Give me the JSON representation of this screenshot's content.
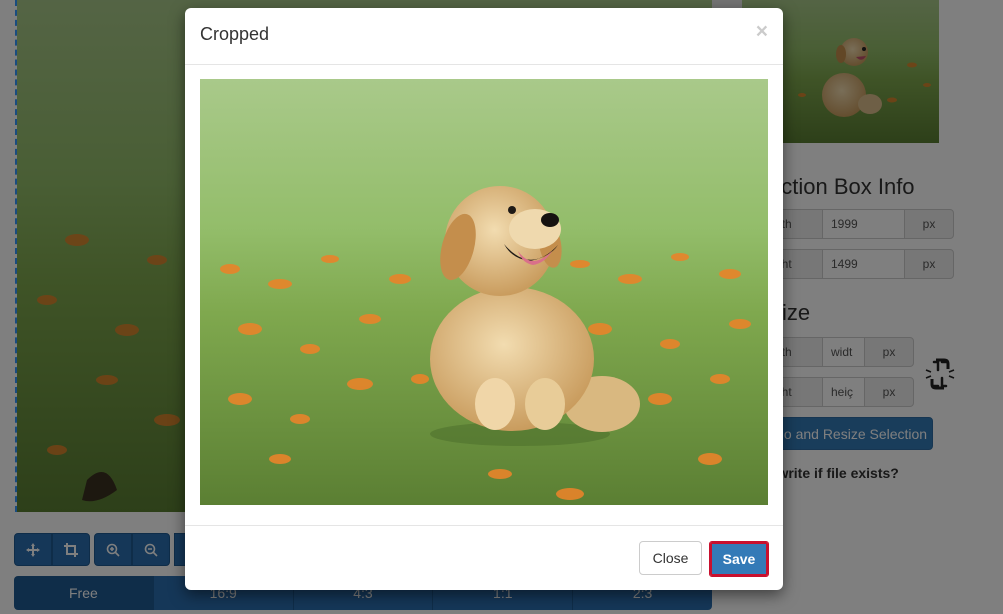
{
  "modal": {
    "title": "Cropped",
    "close_symbol": "×",
    "image_alt": "cropped puppy photo",
    "close_label": "Close",
    "save_label": "Save"
  },
  "aspect_ratios": [
    "Free",
    "16:9",
    "4:3",
    "1:1",
    "2:3"
  ],
  "toolbar": {
    "icons": [
      "move-icon",
      "crop-icon",
      "zoom-in-icon",
      "zoom-out-icon"
    ]
  },
  "sidebar": {
    "section_title": "ection Box Info",
    "width_label": "dth",
    "width_value": "1999",
    "height_label": "ght",
    "height_value": "1499",
    "unit": "px",
    "resize_title": "ize",
    "resize_width_label": "dth",
    "resize_width_placeholder": "widt",
    "resize_height_label": "ght",
    "resize_height_placeholder": "heiç",
    "crop_button": "o and Resize Selection",
    "overwrite_text": "rwrite if file exists?"
  },
  "colors": {
    "primary": "#337ab7",
    "toolbar": "#2a6fb0",
    "save_outline": "#c8102e"
  }
}
